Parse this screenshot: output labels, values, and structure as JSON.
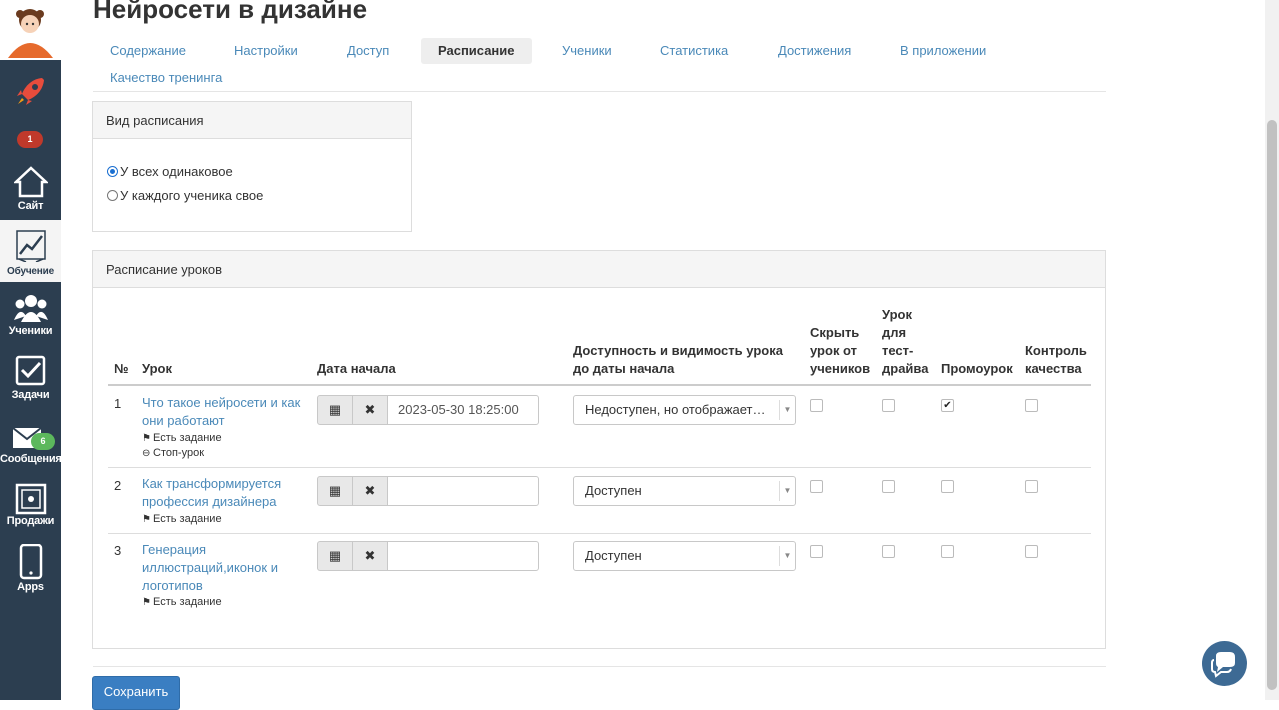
{
  "page": {
    "title": "Нейросети в дизайне"
  },
  "sidebar": {
    "items": [
      {
        "label": "",
        "icon": "rocket-icon"
      },
      {
        "label": "Сайт",
        "icon": "home-icon",
        "badge": "1"
      },
      {
        "label": "Обучение",
        "icon": "chart-icon",
        "active": true
      },
      {
        "label": "Ученики",
        "icon": "users-icon"
      },
      {
        "label": "Задачи",
        "icon": "checkbox-icon"
      },
      {
        "label": "Сообщения",
        "icon": "envelope-icon",
        "badge": "6"
      },
      {
        "label": "Продажи",
        "icon": "sales-icon"
      },
      {
        "label": "Apps",
        "icon": "phone-icon"
      }
    ]
  },
  "tabs": [
    {
      "label": "Содержание"
    },
    {
      "label": "Настройки"
    },
    {
      "label": "Доступ"
    },
    {
      "label": "Расписание",
      "active": true
    },
    {
      "label": "Ученики"
    },
    {
      "label": "Статистика"
    },
    {
      "label": "Достижения"
    },
    {
      "label": "В приложении"
    },
    {
      "label": "Качество тренинга"
    }
  ],
  "schedule_type": {
    "heading": "Вид расписания",
    "options": [
      {
        "label": "У всех одинаковое",
        "selected": true
      },
      {
        "label": "У каждого ученика свое",
        "selected": false
      }
    ]
  },
  "lessons_schedule": {
    "heading": "Расписание уроков",
    "columns": {
      "num": "№",
      "lesson": "Урок",
      "start_date": "Дата начала",
      "availability": "Доступность и видимость урока до даты начала",
      "hide": "Скрыть урок от учеников",
      "test_drive": "Урок для тест-драйва",
      "promo": "Промоурок",
      "quality": "Контроль качества"
    },
    "rows": [
      {
        "num": "1",
        "title": "Что такое нейросети и как они работают",
        "meta": [
          "Есть задание",
          "Стоп-урок"
        ],
        "date": "2023-05-30 18:25:00",
        "availability": "Недоступен, но отображает…",
        "hide": false,
        "test_drive": false,
        "promo": true,
        "quality": false
      },
      {
        "num": "2",
        "title": "Как трансформируется профессия дизайнера",
        "meta": [
          "Есть задание"
        ],
        "date": "",
        "availability": "Доступен",
        "hide": false,
        "test_drive": false,
        "promo": false,
        "quality": false
      },
      {
        "num": "3",
        "title": "Генерация иллюстраций,иконок и логотипов",
        "meta": [
          "Есть задание"
        ],
        "date": "",
        "availability": "Доступен",
        "hide": false,
        "test_drive": false,
        "promo": false,
        "quality": false
      }
    ]
  },
  "actions": {
    "save_label": "Сохранить"
  },
  "icons": {
    "calendar": "calendar-icon",
    "clear": "clear-icon",
    "chat": "chat-icon"
  },
  "colors": {
    "sidebar": "#2c3e50",
    "link": "#4a89b8",
    "primary_button": "#3a7ec2",
    "badge_red": "#c0392b",
    "badge_green": "#5cb85c"
  }
}
